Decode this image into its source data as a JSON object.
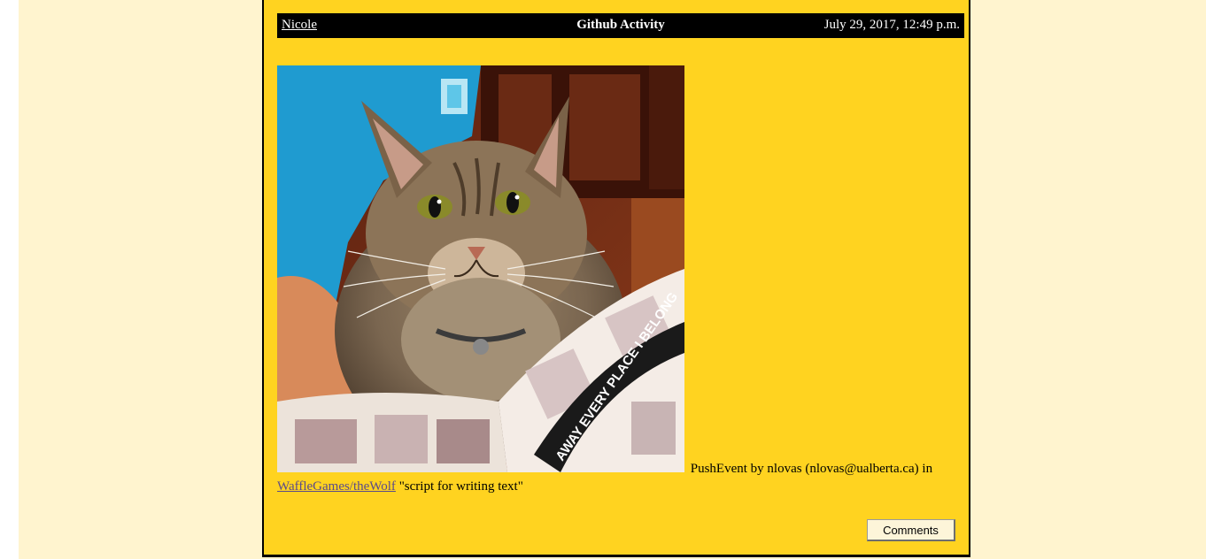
{
  "post": {
    "author": "Nicole",
    "title": "Github Activity",
    "timestamp": "July 29, 2017, 12:49 p.m.",
    "image": {
      "alt": "cat photo",
      "comic_text": "AWAY EVERY PLACE I BELONG"
    },
    "body": {
      "prefix": "PushEvent by nlovas (nlovas@ualberta.ca) in",
      "repo_link": "WaffleGames/theWolf",
      "message": "\"script for writing text\""
    },
    "comments_label": "Comments"
  },
  "colors": {
    "page_background": "#fff4cf",
    "card_background": "#ffd320",
    "header_background": "#000000",
    "link": "#5a4a8a"
  }
}
